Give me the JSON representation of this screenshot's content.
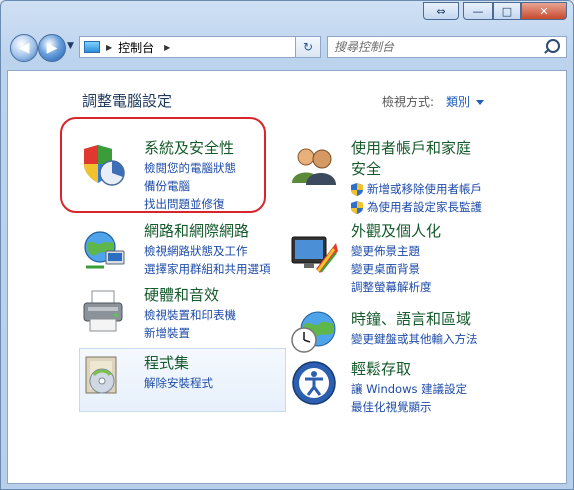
{
  "window": {
    "caption_buttons": {
      "swap": "⇔",
      "min": "—",
      "max": "□",
      "close": "✕"
    }
  },
  "nav": {
    "address_path": "控制台",
    "search_placeholder": "搜尋控制台"
  },
  "page": {
    "title": "調整電腦設定",
    "view_label": "檢視方式:",
    "view_value": "類別"
  },
  "categories": [
    {
      "title": "系統及安全性",
      "links": [
        "檢閱您的電腦狀態",
        "備份電腦",
        "找出問題並修復"
      ]
    },
    {
      "title": "網路和網際網路",
      "links": [
        "檢視網路狀態及工作",
        "選擇家用群組和共用選項"
      ]
    },
    {
      "title": "硬體和音效",
      "links": [
        "檢視裝置和印表機",
        "新增裝置"
      ]
    },
    {
      "title": "程式集",
      "links": [
        "解除安裝程式"
      ]
    },
    {
      "title_line1": "使用者帳戶和家庭",
      "title_line2": "安全",
      "links": [
        "新增或移除使用者帳戶",
        "為使用者設定家長監護"
      ]
    },
    {
      "title": "外觀及個人化",
      "links": [
        "變更佈景主題",
        "變更桌面背景",
        "調整螢幕解析度"
      ]
    },
    {
      "title": "時鐘、語言和區域",
      "links": [
        "變更鍵盤或其他輸入方法"
      ]
    },
    {
      "title": "輕鬆存取",
      "links": [
        "讓 Windows 建議設定",
        "最佳化視覺顯示"
      ]
    }
  ],
  "colors": {
    "highlight_border": "#d8252c",
    "category_title": "#155a2b",
    "link": "#1d4ba8"
  }
}
